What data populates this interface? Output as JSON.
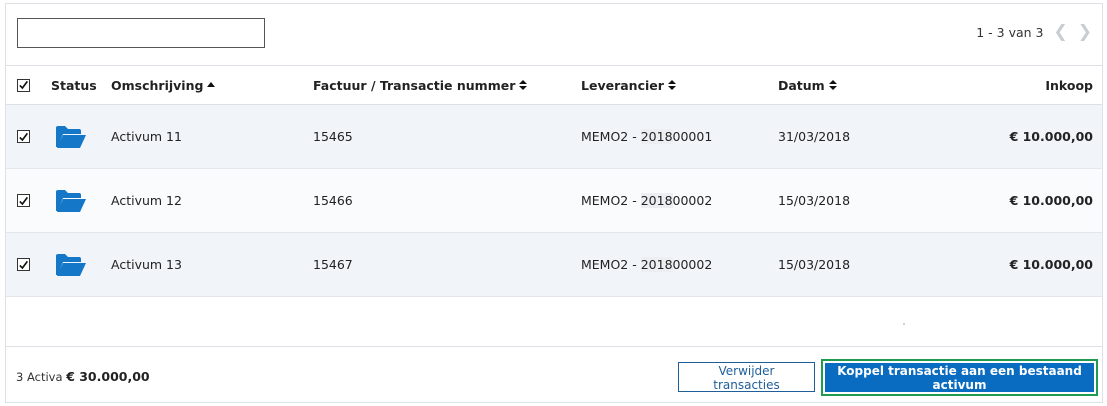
{
  "search": {
    "value": "",
    "placeholder": ""
  },
  "pager": {
    "label": "1 - 3 van 3",
    "prev_icon": "chevron-left-icon",
    "next_icon": "chevron-right-icon"
  },
  "headers": {
    "status": "Status",
    "description": "Omschrijving",
    "invoice": "Factuur / Transactie nummer",
    "supplier": "Leverancier",
    "date": "Datum",
    "purchase": "Inkoop"
  },
  "rows": [
    {
      "checked": true,
      "status_icon": "folder-open-icon",
      "description": "Activum 11",
      "invoice": "15465",
      "supplier_prefix": "MEMO2 - ",
      "supplier_year": "2018",
      "supplier_suffix": "00001",
      "date": "31/03/2018",
      "purchase": "€ 10.000,00"
    },
    {
      "checked": true,
      "status_icon": "folder-open-icon",
      "description": "Activum 12",
      "invoice": "15466",
      "supplier_prefix": "MEMO2 - ",
      "supplier_year": "2018",
      "supplier_suffix": "00002",
      "date": "15/03/2018",
      "purchase": "€ 10.000,00"
    },
    {
      "checked": true,
      "status_icon": "folder-open-icon",
      "description": "Activum 13",
      "invoice": "15467",
      "supplier_prefix": "MEMO2 - ",
      "supplier_year": "2018",
      "supplier_suffix": "00002",
      "date": "15/03/2018",
      "purchase": "€ 10.000,00"
    }
  ],
  "footer": {
    "count_label": "3 Activa",
    "total": "€ 30.000,00",
    "remove_button": "Verwijder transacties",
    "link_button": "Koppel transactie aan een bestaand activum"
  },
  "colors": {
    "accent": "#0a6cc1",
    "focus": "#1f9a4f",
    "folder": "#1577c8"
  }
}
